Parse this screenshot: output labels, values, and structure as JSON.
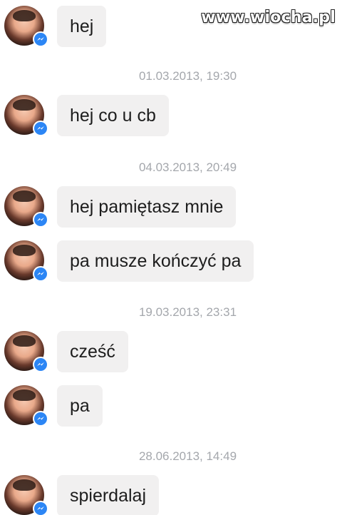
{
  "watermark": "www.wiocha.pl",
  "conversation": {
    "accent_color": "#2c86f5",
    "bubble_color": "#f1f0f0",
    "timestamp_color": "#a4a7ac",
    "avatar_icon": "profile-photo",
    "badge_icon": "messenger-icon",
    "messages": [
      {
        "text": "hej"
      },
      {
        "timestamp": "01.03.2013, 19:30"
      },
      {
        "text": "hej co u cb"
      },
      {
        "timestamp": "04.03.2013, 20:49"
      },
      {
        "text": "hej pamiętasz mnie"
      },
      {
        "text": "pa musze kończyć pa"
      },
      {
        "timestamp": "19.03.2013, 23:31"
      },
      {
        "text": "cześć"
      },
      {
        "text": "pa"
      },
      {
        "timestamp": "28.06.2013, 14:49"
      },
      {
        "text": "spierdalaj"
      }
    ]
  }
}
